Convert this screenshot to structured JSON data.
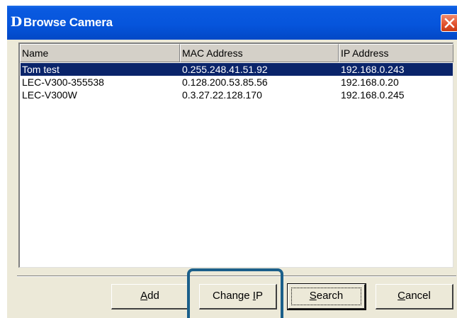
{
  "window": {
    "title": "Browse Camera",
    "logo_letter": "D",
    "close_glyph": "close-icon"
  },
  "columns": [
    "Name",
    "MAC Address",
    "IP Address"
  ],
  "rows": [
    {
      "name": "Tom test",
      "mac": "0.255.248.41.51.92",
      "ip": "192.168.0.243",
      "selected": true
    },
    {
      "name": "LEC-V300-355538",
      "mac": "0.128.200.53.85.56",
      "ip": "192.168.0.20",
      "selected": false
    },
    {
      "name": "LEC-V300W",
      "mac": "0.3.27.22.128.170",
      "ip": "192.168.0.245",
      "selected": false
    }
  ],
  "buttons": {
    "add": {
      "label": "Add",
      "mnemonic": "A"
    },
    "change_ip": {
      "label": "Change IP",
      "mnemonic": "I"
    },
    "search": {
      "label": "Search",
      "mnemonic": "S"
    },
    "cancel": {
      "label": "Cancel",
      "mnemonic": "C"
    }
  },
  "colors": {
    "title_bar": "#0655dc",
    "selection": "#0a246a",
    "highlight_frame": "#1b5f8a",
    "dialog_face": "#ece9d8"
  }
}
